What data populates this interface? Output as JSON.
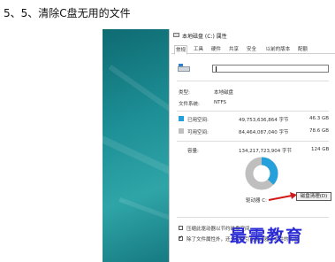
{
  "heading": "5、5、清除C盘无用的文件",
  "dialog": {
    "title": "本地磁盘 (C:) 属性",
    "tabs": [
      "常规",
      "工具",
      "硬件",
      "共享",
      "安全",
      "以前的版本",
      "配额"
    ],
    "active_tab": "常规",
    "name_value": "",
    "type_label": "类型:",
    "type_value": "本地磁盘",
    "fs_label": "文件系统:",
    "fs_value": "NTFS",
    "used_label": "已用空间:",
    "used_bytes": "49,753,636,864 字节",
    "used_size": "46.3 GB",
    "free_label": "可用空间:",
    "free_bytes": "84,464,087,040 字节",
    "free_size": "78.6 GB",
    "cap_label": "容量:",
    "cap_bytes": "134,217,723,904 字节",
    "cap_size": "124 GB",
    "drive_label": "驱动器 C:",
    "cleanup_button": "磁盘清理(D)",
    "compress_label": "压缩此驱动器以节约磁盘空间",
    "index_label": "除了文件属性外，还允许索引此驱动器上文件的内容",
    "compress_checked": false,
    "index_checked": true,
    "used_fraction": 0.371
  },
  "watermark": "最需教育",
  "colors": {
    "used": "#26a0da",
    "free": "#bfbfbf",
    "arrow": "#d11a1a",
    "watermark": "#2b2bd6"
  }
}
